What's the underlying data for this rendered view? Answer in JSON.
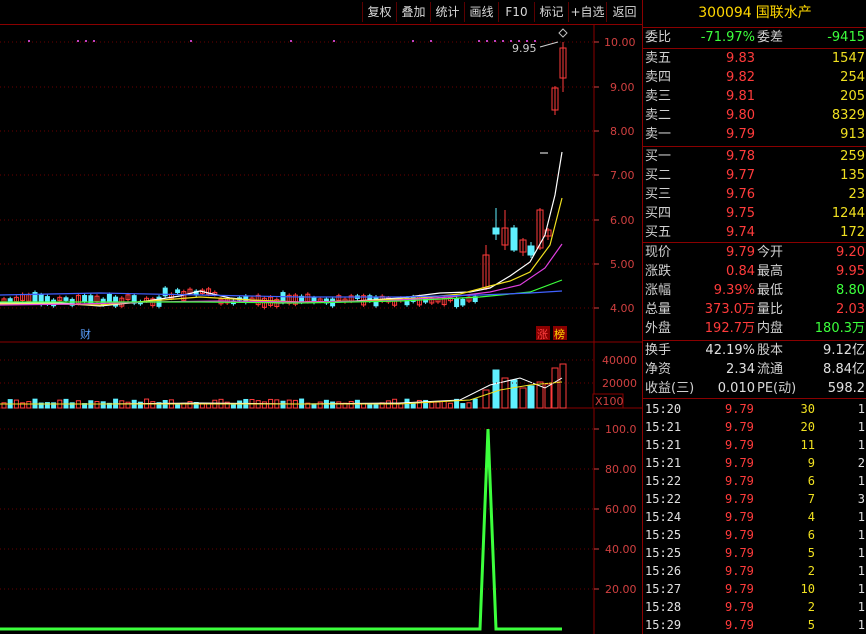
{
  "toolbar": {
    "buttons": [
      "复权",
      "叠加",
      "统计",
      "画线",
      "F10",
      "标记",
      "+自选",
      "返回"
    ]
  },
  "chart": {
    "price_axis": [
      "10.00",
      "9.00",
      "8.00",
      "7.00",
      "6.00",
      "5.00",
      "4.00"
    ],
    "high_annotation": "9.95",
    "markers": {
      "cai": "财",
      "zhang": "涨",
      "bang": "榜"
    },
    "volume_axis": [
      "40000",
      "20000"
    ],
    "volume_unit": "X100",
    "indicator_axis": [
      "100.0",
      "80.00",
      "60.00",
      "40.00",
      "20.00"
    ]
  },
  "quote": {
    "code": "300094",
    "name": "国联水产",
    "weibi_label": "委比",
    "weibi_value": "-71.97%",
    "weicha_label": "委差",
    "weicha_value": "-9415",
    "asks": [
      {
        "label": "卖五",
        "price": "9.83",
        "volume": "1547"
      },
      {
        "label": "卖四",
        "price": "9.82",
        "volume": "254"
      },
      {
        "label": "卖三",
        "price": "9.81",
        "volume": "205"
      },
      {
        "label": "卖二",
        "price": "9.80",
        "volume": "8329"
      },
      {
        "label": "卖一",
        "price": "9.79",
        "volume": "913"
      }
    ],
    "bids": [
      {
        "label": "买一",
        "price": "9.78",
        "volume": "259"
      },
      {
        "label": "买二",
        "price": "9.77",
        "volume": "135"
      },
      {
        "label": "买三",
        "price": "9.76",
        "volume": "23"
      },
      {
        "label": "买四",
        "price": "9.75",
        "volume": "1244"
      },
      {
        "label": "买五",
        "price": "9.74",
        "volume": "172"
      }
    ],
    "stats": [
      {
        "l1": "现价",
        "v1": "9.79",
        "l2": "今开",
        "v2": "9.20"
      },
      {
        "l1": "涨跌",
        "v1": "0.84",
        "l2": "最高",
        "v2": "9.95"
      },
      {
        "l1": "涨幅",
        "v1": "9.39%",
        "l2": "最低",
        "v2": "8.80"
      },
      {
        "l1": "总量",
        "v1": "373.0万",
        "l2": "量比",
        "v2": "2.03"
      },
      {
        "l1": "外盘",
        "v1": "192.7万",
        "l2": "内盘",
        "v2": "180.3万"
      }
    ],
    "fin": [
      {
        "l1": "换手",
        "v1": "42.19%",
        "l2": "股本",
        "v2": "9.12亿"
      },
      {
        "l1": "净资",
        "v1": "2.34",
        "l2": "流通",
        "v2": "8.84亿"
      },
      {
        "l1": "收益(三)",
        "v1": "0.010",
        "l2": "PE(动)",
        "v2": "598.2"
      }
    ],
    "ticks": [
      {
        "time": "15:20",
        "price": "9.79",
        "vol": "30",
        "n": "1"
      },
      {
        "time": "15:21",
        "price": "9.79",
        "vol": "20",
        "n": "1"
      },
      {
        "time": "15:21",
        "price": "9.79",
        "vol": "11",
        "n": "1"
      },
      {
        "time": "15:21",
        "price": "9.79",
        "vol": "9",
        "n": "2"
      },
      {
        "time": "15:22",
        "price": "9.79",
        "vol": "6",
        "n": "1"
      },
      {
        "time": "15:22",
        "price": "9.79",
        "vol": "7",
        "n": "3"
      },
      {
        "time": "15:24",
        "price": "9.79",
        "vol": "4",
        "n": "1"
      },
      {
        "time": "15:25",
        "price": "9.79",
        "vol": "6",
        "n": "1"
      },
      {
        "time": "15:25",
        "price": "9.79",
        "vol": "5",
        "n": "1"
      },
      {
        "time": "15:26",
        "price": "9.79",
        "vol": "2",
        "n": "1"
      },
      {
        "time": "15:27",
        "price": "9.79",
        "vol": "10",
        "n": "1"
      },
      {
        "time": "15:28",
        "price": "9.79",
        "vol": "2",
        "n": "1"
      },
      {
        "time": "15:29",
        "price": "9.79",
        "vol": "5",
        "n": "1"
      }
    ]
  }
}
